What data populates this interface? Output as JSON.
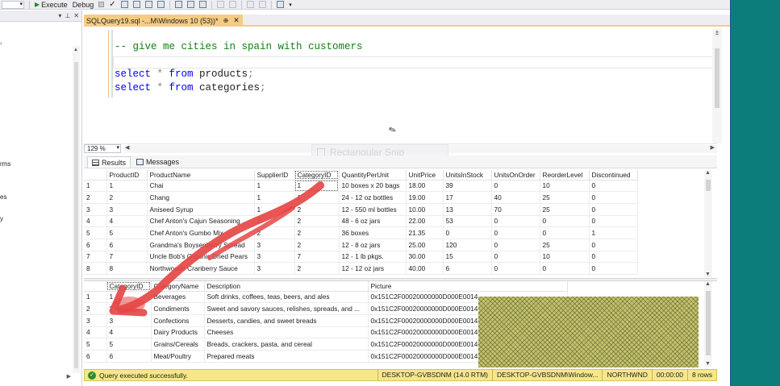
{
  "toolbar": {
    "execute_label": "Execute",
    "debug_label": "Debug"
  },
  "left_panel": {
    "items": [
      {
        "label": "rms"
      },
      {
        "label": "es"
      },
      {
        "label": "y"
      }
    ]
  },
  "tab": {
    "title": "SQLQuery19.sql -...M\\Windows 10 (53))*"
  },
  "editor": {
    "lines": [
      {
        "parts": [
          {
            "t": "-- give me cities in spain with customers",
            "c": "comment"
          }
        ]
      },
      {
        "parts": [
          {
            "t": "select",
            "c": "kw"
          },
          {
            "t": " * ",
            "c": "gray"
          },
          {
            "t": "from",
            "c": "kw"
          },
          {
            "t": " products",
            "c": "txt"
          },
          {
            "t": ";",
            "c": "gray"
          }
        ]
      },
      {
        "parts": [
          {
            "t": "select",
            "c": "kw"
          },
          {
            "t": " * ",
            "c": "gray"
          },
          {
            "t": "from",
            "c": "kw"
          },
          {
            "t": " categories",
            "c": "txt"
          },
          {
            "t": ";",
            "c": "gray"
          }
        ]
      }
    ]
  },
  "zoom": {
    "value": "129 %"
  },
  "snip_overlay": {
    "label": "Rectangular Snip"
  },
  "results_tabs": [
    {
      "label": "Results",
      "active": true
    },
    {
      "label": "Messages",
      "active": false
    }
  ],
  "products_grid": {
    "columns": [
      "",
      "ProductID",
      "ProductName",
      "SupplierID",
      "CategoryID",
      "QuantityPerUnit",
      "UnitPrice",
      "UnitsInStock",
      "UnitsOnOrder",
      "ReorderLevel",
      "Discontinued"
    ],
    "rows": [
      [
        "1",
        "1",
        "Chai",
        "1",
        "1",
        "10 boxes x 20 bags",
        "18.00",
        "39",
        "0",
        "10",
        "0"
      ],
      [
        "2",
        "2",
        "Chang",
        "1",
        "1",
        "24 - 12 oz bottles",
        "19.00",
        "17",
        "40",
        "25",
        "0"
      ],
      [
        "3",
        "3",
        "Aniseed Syrup",
        "1",
        "2",
        "12 - 550 ml bottles",
        "10.00",
        "13",
        "70",
        "25",
        "0"
      ],
      [
        "4",
        "4",
        "Chef Anton's Cajun Seasoning",
        "2",
        "2",
        "48 - 6 oz jars",
        "22.00",
        "53",
        "0",
        "0",
        "0"
      ],
      [
        "5",
        "5",
        "Chef Anton's Gumbo Mix",
        "2",
        "2",
        "36 boxes",
        "21.35",
        "0",
        "0",
        "0",
        "1"
      ],
      [
        "6",
        "6",
        "Grandma's Boysenberry Spread",
        "3",
        "2",
        "12 - 8 oz jars",
        "25.00",
        "120",
        "0",
        "25",
        "0"
      ],
      [
        "7",
        "7",
        "Uncle Bob's Organic Dried Pears",
        "3",
        "7",
        "12 - 1 lb pkgs.",
        "30.00",
        "15",
        "0",
        "10",
        "0"
      ],
      [
        "8",
        "8",
        "Northwoods Cranberry Sauce",
        "3",
        "2",
        "12 - 12 oz jars",
        "40.00",
        "6",
        "0",
        "0",
        "0"
      ]
    ]
  },
  "categories_grid": {
    "columns": [
      "",
      "CategoryID",
      "CategoryName",
      "Description",
      "Picture"
    ],
    "rows": [
      [
        "1",
        "1",
        "Beverages",
        "Soft drinks, coffees, teas, beers, and ales",
        "0x151C2F00020000000D000E0014"
      ],
      [
        "2",
        "2",
        "Condiments",
        "Sweet and savory sauces, relishes, spreads, and ...",
        "0x151C2F00020000000D000E0014"
      ],
      [
        "3",
        "3",
        "Confections",
        "Desserts, candies, and sweet breads",
        "0x151C2F00020000000D000E0014"
      ],
      [
        "4",
        "4",
        "Dairy Products",
        "Cheeses",
        "0x151C2F00020000000D000E0014"
      ],
      [
        "5",
        "5",
        "Grains/Cereals",
        "Breads, crackers, pasta, and cereal",
        "0x151C2F00020000000D000E0014"
      ],
      [
        "6",
        "6",
        "Meat/Poultry",
        "Prepared meats",
        "0x151C2F00020000000D000E0014"
      ]
    ]
  },
  "status": {
    "message": "Query executed successfully.",
    "server": "DESKTOP-GVBSDNM (14.0 RTM)",
    "user": "DESKTOP-GVBSDNM\\Window...",
    "database": "NORTHWND",
    "elapsed": "00:00:00",
    "rows": "8 rows"
  },
  "colors": {
    "tab_accent": "#f5cc84",
    "status_bg": "#f5e78a",
    "annotation": "#e64646",
    "desktop": "#0c7d7a"
  }
}
